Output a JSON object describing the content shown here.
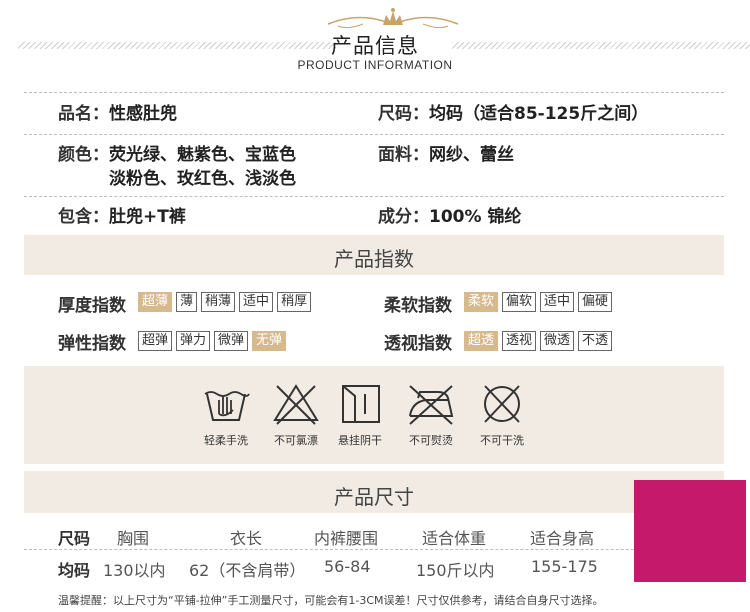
{
  "header": {
    "title": "产品信息",
    "subtitle": "PRODUCT INFORMATION"
  },
  "info": {
    "name_label": "品名：",
    "name_value": "性感肚兜",
    "size_label": "尺码：",
    "size_value": "均码（适合85-125斤之间）",
    "color_label": "颜色：",
    "color_line1": "荧光绿、魅紫色、宝蓝色",
    "color_line2": "淡粉色、玫红色、浅淡色",
    "fabric_label": "面料：",
    "fabric_value": "网纱、蕾丝",
    "include_label": "包含：",
    "include_value": "肚兜+T裤",
    "composition_label": "成分：",
    "composition_value": "100% 锦纶"
  },
  "index": {
    "title": "产品指数",
    "thickness": {
      "label": "厚度指数",
      "options": [
        "超薄",
        "薄",
        "稍薄",
        "适中",
        "稍厚"
      ],
      "selected": 0
    },
    "softness": {
      "label": "柔软指数",
      "options": [
        "柔软",
        "偏软",
        "适中",
        "偏硬"
      ],
      "selected": 0
    },
    "elasticity": {
      "label": "弹性指数",
      "options": [
        "超弹",
        "弹力",
        "微弹",
        "无弹"
      ],
      "selected": 3
    },
    "transparency": {
      "label": "透视指数",
      "options": [
        "超透",
        "透视",
        "微透",
        "不透"
      ],
      "selected": 0
    }
  },
  "care": [
    {
      "icon": "hand-wash-icon",
      "label": "轻柔手洗"
    },
    {
      "icon": "no-bleach-icon",
      "label": "不可氯漂"
    },
    {
      "icon": "hang-dry-icon",
      "label": "悬挂阴干"
    },
    {
      "icon": "no-iron-icon",
      "label": "不可熨烫"
    },
    {
      "icon": "no-dry-clean-icon",
      "label": "不可干洗"
    }
  ],
  "size_table": {
    "title": "产品尺寸",
    "headers": [
      "尺码",
      "胸围",
      "衣长",
      "内裤腰围",
      "适合体重",
      "适合身高"
    ],
    "row": [
      "均码",
      "130以内",
      "62（不含肩带）",
      "56-84",
      "150斤以内",
      "155-175"
    ]
  },
  "footnote": "温馨提醒：以上尺寸为“平铺-拉伸”手工测量尺寸，可能会有1-3CM误差！尺寸仅供参考，请结合自身尺寸选择。",
  "colors": {
    "band": "#f1ebe3",
    "selected": "#d6b98c",
    "overlay": "#c51a6b"
  }
}
